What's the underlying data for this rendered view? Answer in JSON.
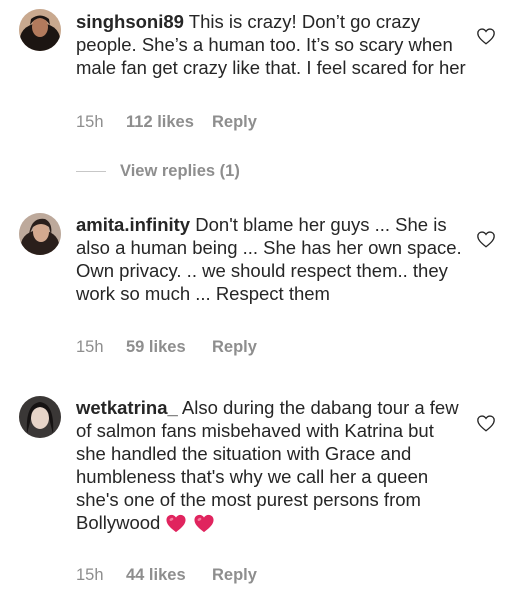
{
  "comments": [
    {
      "username": "singhsoni89",
      "text": "This is crazy! Don’t go crazy people. She’s a human too. It’s so scary when male fan get crazy like that. I feel scared for her",
      "time": "15h",
      "likes": "112 likes",
      "reply": "Reply",
      "heart_icon": "heart-outline-icon"
    },
    {
      "username": "amita.infinity",
      "text": "Don't blame her guys ... She is also a human being ... She has her own space.  Own privacy. .. we should respect them.. they work so much ... Respect them",
      "time": "15h",
      "likes": "59 likes",
      "reply": "Reply",
      "heart_icon": "heart-outline-icon"
    },
    {
      "username": "wetkatrina_",
      "text": "Also during the dabang tour a few of salmon fans misbehaved with Katrina but she handled the situation with Grace and humbleness that's why we call her a queen she's one of the most purest persons from Bollywood",
      "emoji": "red-heart-emoji x2",
      "time": "15h",
      "likes": "44 likes",
      "reply": "Reply",
      "heart_icon": "heart-outline-icon"
    }
  ],
  "view_replies": "View replies (1)",
  "colors": {
    "text": "#262626",
    "meta": "#8e8e8e",
    "emoji_heart": "#e0245e"
  }
}
